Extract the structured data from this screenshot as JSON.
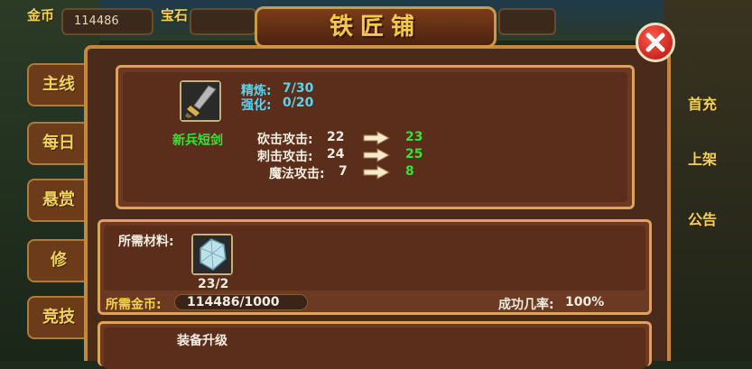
{
  "top_bar": {
    "gold_label": "金币",
    "gold_value": "114486",
    "gem_label": "宝石"
  },
  "side_menu": [
    {
      "label": "主线"
    },
    {
      "label": "每日"
    },
    {
      "label": "悬赏"
    },
    {
      "label": "修"
    },
    {
      "label": "竞技"
    }
  ],
  "right_menu": [
    {
      "label": "首充"
    },
    {
      "label": "上架"
    },
    {
      "label": "公告"
    }
  ],
  "title": "铁匠铺",
  "item": {
    "name": "新兵短剑",
    "refine_label": "精炼:",
    "refine_value": "7/30",
    "enhance_label": "强化:",
    "enhance_value": "0/20",
    "stats": [
      {
        "label": "砍击攻击:",
        "current": "22",
        "next": "23"
      },
      {
        "label": "刺击攻击:",
        "current": "24",
        "next": "25"
      },
      {
        "label": "魔法攻击:",
        "current": "7",
        "next": "8"
      }
    ]
  },
  "materials": {
    "label": "所需材料:",
    "crystal_count": "23/2"
  },
  "gold_required": {
    "label": "所需金币:",
    "value": "114486/1000",
    "fill_fraction": 1.0
  },
  "success_rate": {
    "label": "成功几率:",
    "value": "100%"
  },
  "upgrade": {
    "label": "装备升级"
  },
  "colors": {
    "accent_green": "#36e23a",
    "accent_cyan": "#59d4f0",
    "accent_yellow": "#f4d24a",
    "frame_orange": "#c8863a"
  }
}
